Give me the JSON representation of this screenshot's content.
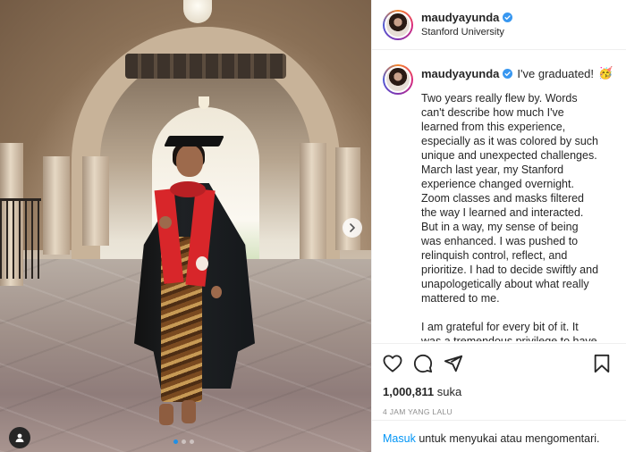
{
  "post": {
    "username": "maudyayunda",
    "location": "Stanford University",
    "verified": true,
    "caption_title": "I've graduated!",
    "caption_emoji": "🥳",
    "caption_body": "Two years really flew by. Words can't describe how much I've learned from this experience, especially as it was colored by such unique and unexpected challenges. March last year, my Stanford experience changed overnight. Zoom classes and masks filtered the way I learned and interacted. But in a way, my sense of being was enhanced. I was pushed to relinquish control, reflect, and prioritize. I had to decide swiftly and unapologetically about what really mattered to me.\n\nI am grateful for every bit of it. It was a tremendous privilege to have walked these walls. Here's hoping I",
    "likes_count": "1,000,811",
    "likes_label": "suka",
    "timestamp": "4 JAM YANG LALU"
  },
  "carousel": {
    "slides": 3,
    "active_index": 0
  },
  "login_prompt": {
    "link": "Masuk",
    "text": "untuk menyukai atau mengomentari."
  },
  "icons": {
    "like": "heart-icon",
    "comment": "comment-icon",
    "share": "share-icon",
    "save": "bookmark-icon",
    "verified": "verified-badge-icon",
    "next": "chevron-right-icon",
    "tag": "user-tag-icon"
  },
  "colors": {
    "link": "#0095f6",
    "verified": "#3897f0",
    "active_dot": "#1f8fe6",
    "muted_text": "#8e8e8e"
  }
}
